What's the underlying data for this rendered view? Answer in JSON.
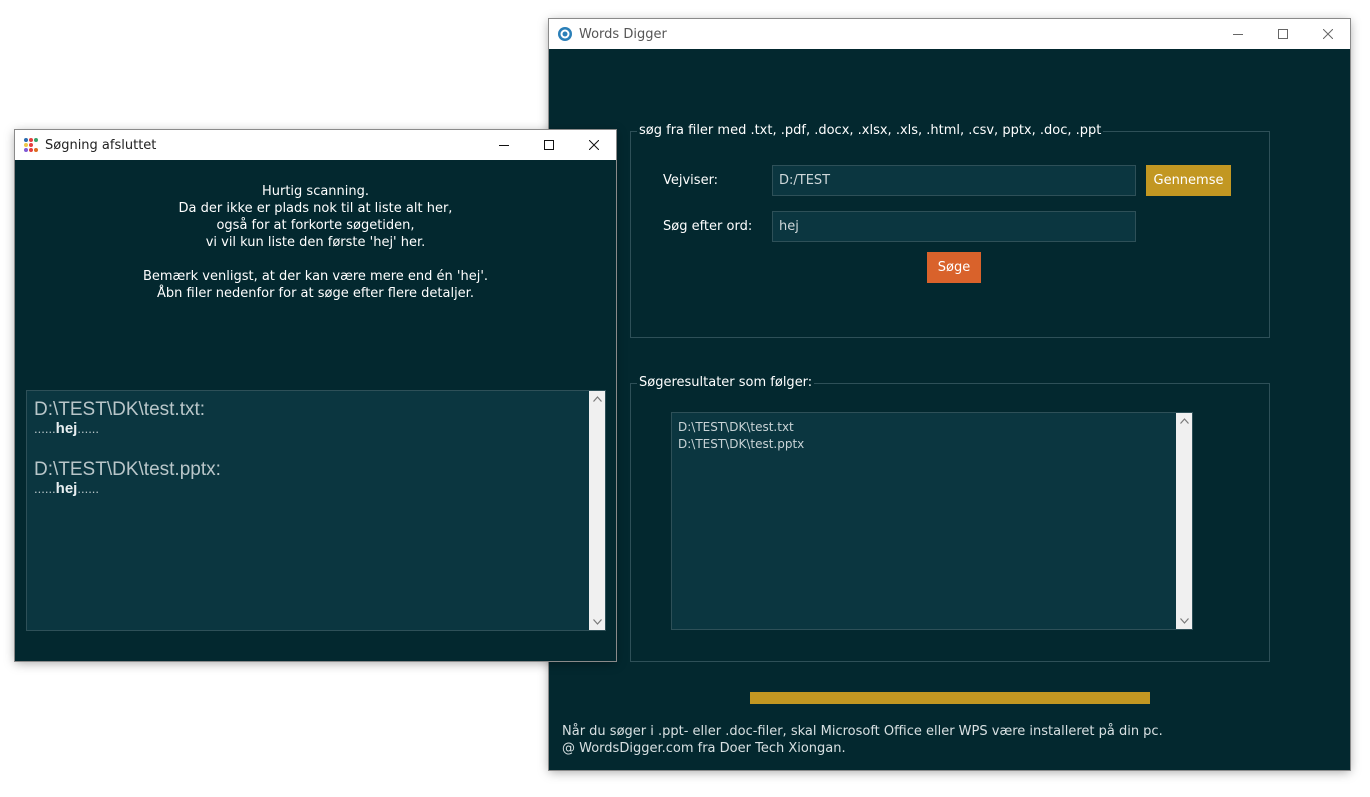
{
  "main_window": {
    "title": "Words Digger",
    "search_group": {
      "legend": "søg fra filer med .txt, .pdf, .docx, .xlsx, .xls, .html, .csv, pptx, .doc, .ppt",
      "dir_label": "Vejviser:",
      "dir_value": "D:/TEST",
      "browse_label": "Gennemse",
      "word_label": "Søg efter ord:",
      "word_value": "hej",
      "search_label": "Søge"
    },
    "results_group": {
      "legend": "Søgeresultater som følger:",
      "results": [
        "D:\\TEST\\DK\\test.txt",
        "D:\\TEST\\DK\\test.pptx"
      ]
    },
    "progress_percent": 100,
    "footer_line1": "Når du søger i .ppt- eller .doc-filer, skal Microsoft Office eller WPS være installeret på din pc.",
    "footer_line2": "@ WordsDigger.com fra Doer Tech Xiongan."
  },
  "popup_window": {
    "title": "Søgning afsluttet",
    "message_lines": [
      "Hurtig scanning.",
      "Da der ikke er plads nok til at liste alt her,",
      "også for at forkorte søgetiden,",
      "vi vil kun liste den første 'hej' her."
    ],
    "note_lines": [
      "Bemærk venligst, at der kan være mere end én 'hej'.",
      "Åbn filer nedenfor for at søge efter flere detaljer."
    ],
    "entries": [
      {
        "path": "D:\\TEST\\DK\\test.txt:",
        "prefix": "......",
        "word": "hej",
        "suffix": "......"
      },
      {
        "path": "D:\\TEST\\DK\\test.pptx:",
        "prefix": "......",
        "word": "hej",
        "suffix": "......"
      }
    ]
  },
  "colors": {
    "background": "#03282f",
    "browse_button": "#c29722",
    "search_button": "#d9622b",
    "progress": "#c29722"
  }
}
